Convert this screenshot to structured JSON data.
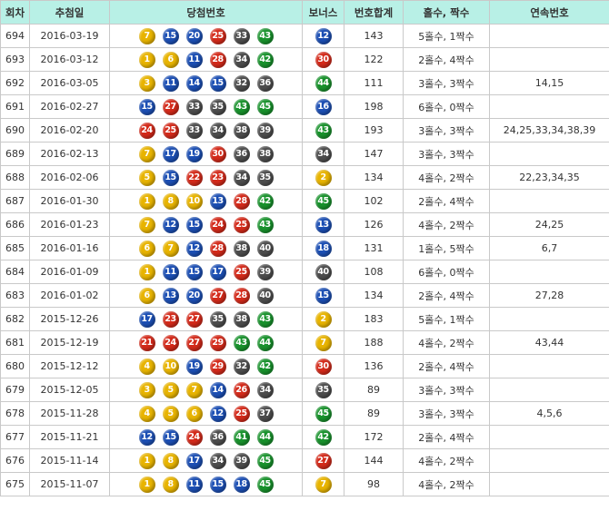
{
  "colors": {
    "header_bg": "#b8f0e6",
    "border": "#c9c9c9",
    "ball_yellow": "#e8b400",
    "ball_blue": "#1c4fb4",
    "ball_red": "#d42a1a",
    "ball_gray": "#4d4d4d",
    "ball_green": "#18922c"
  },
  "headers": {
    "round": "회차",
    "date": "추첨일",
    "winning": "당첨번호",
    "bonus": "보너스",
    "sum": "번호합계",
    "oddeven": "홀수, 짝수",
    "consec": "연속번호"
  },
  "rows": [
    {
      "round": "694",
      "date": "2016-03-19",
      "nums": [
        "7",
        "15",
        "20",
        "25",
        "33",
        "43"
      ],
      "bonus": "12",
      "sum": "143",
      "oddeven": "5홀수, 1짝수",
      "consec": ""
    },
    {
      "round": "693",
      "date": "2016-03-12",
      "nums": [
        "1",
        "6",
        "11",
        "28",
        "34",
        "42"
      ],
      "bonus": "30",
      "sum": "122",
      "oddeven": "2홀수, 4짝수",
      "consec": ""
    },
    {
      "round": "692",
      "date": "2016-03-05",
      "nums": [
        "3",
        "11",
        "14",
        "15",
        "32",
        "36"
      ],
      "bonus": "44",
      "sum": "111",
      "oddeven": "3홀수, 3짝수",
      "consec": "14,15"
    },
    {
      "round": "691",
      "date": "2016-02-27",
      "nums": [
        "15",
        "27",
        "33",
        "35",
        "43",
        "45"
      ],
      "bonus": "16",
      "sum": "198",
      "oddeven": "6홀수, 0짝수",
      "consec": ""
    },
    {
      "round": "690",
      "date": "2016-02-20",
      "nums": [
        "24",
        "25",
        "33",
        "34",
        "38",
        "39"
      ],
      "bonus": "43",
      "sum": "193",
      "oddeven": "3홀수, 3짝수",
      "consec": "24,25,33,34,38,39"
    },
    {
      "round": "689",
      "date": "2016-02-13",
      "nums": [
        "7",
        "17",
        "19",
        "30",
        "36",
        "38"
      ],
      "bonus": "34",
      "sum": "147",
      "oddeven": "3홀수, 3짝수",
      "consec": ""
    },
    {
      "round": "688",
      "date": "2016-02-06",
      "nums": [
        "5",
        "15",
        "22",
        "23",
        "34",
        "35"
      ],
      "bonus": "2",
      "sum": "134",
      "oddeven": "4홀수, 2짝수",
      "consec": "22,23,34,35"
    },
    {
      "round": "687",
      "date": "2016-01-30",
      "nums": [
        "1",
        "8",
        "10",
        "13",
        "28",
        "42"
      ],
      "bonus": "45",
      "sum": "102",
      "oddeven": "2홀수, 4짝수",
      "consec": ""
    },
    {
      "round": "686",
      "date": "2016-01-23",
      "nums": [
        "7",
        "12",
        "15",
        "24",
        "25",
        "43"
      ],
      "bonus": "13",
      "sum": "126",
      "oddeven": "4홀수, 2짝수",
      "consec": "24,25"
    },
    {
      "round": "685",
      "date": "2016-01-16",
      "nums": [
        "6",
        "7",
        "12",
        "28",
        "38",
        "40"
      ],
      "bonus": "18",
      "sum": "131",
      "oddeven": "1홀수, 5짝수",
      "consec": "6,7"
    },
    {
      "round": "684",
      "date": "2016-01-09",
      "nums": [
        "1",
        "11",
        "15",
        "17",
        "25",
        "39"
      ],
      "bonus": "40",
      "sum": "108",
      "oddeven": "6홀수, 0짝수",
      "consec": ""
    },
    {
      "round": "683",
      "date": "2016-01-02",
      "nums": [
        "6",
        "13",
        "20",
        "27",
        "28",
        "40"
      ],
      "bonus": "15",
      "sum": "134",
      "oddeven": "2홀수, 4짝수",
      "consec": "27,28"
    },
    {
      "round": "682",
      "date": "2015-12-26",
      "nums": [
        "17",
        "23",
        "27",
        "35",
        "38",
        "43"
      ],
      "bonus": "2",
      "sum": "183",
      "oddeven": "5홀수, 1짝수",
      "consec": ""
    },
    {
      "round": "681",
      "date": "2015-12-19",
      "nums": [
        "21",
        "24",
        "27",
        "29",
        "43",
        "44"
      ],
      "bonus": "7",
      "sum": "188",
      "oddeven": "4홀수, 2짝수",
      "consec": "43,44"
    },
    {
      "round": "680",
      "date": "2015-12-12",
      "nums": [
        "4",
        "10",
        "19",
        "29",
        "32",
        "42"
      ],
      "bonus": "30",
      "sum": "136",
      "oddeven": "2홀수, 4짝수",
      "consec": ""
    },
    {
      "round": "679",
      "date": "2015-12-05",
      "nums": [
        "3",
        "5",
        "7",
        "14",
        "26",
        "34"
      ],
      "bonus": "35",
      "sum": "89",
      "oddeven": "3홀수, 3짝수",
      "consec": ""
    },
    {
      "round": "678",
      "date": "2015-11-28",
      "nums": [
        "4",
        "5",
        "6",
        "12",
        "25",
        "37"
      ],
      "bonus": "45",
      "sum": "89",
      "oddeven": "3홀수, 3짝수",
      "consec": "4,5,6"
    },
    {
      "round": "677",
      "date": "2015-11-21",
      "nums": [
        "12",
        "15",
        "24",
        "36",
        "41",
        "44"
      ],
      "bonus": "42",
      "sum": "172",
      "oddeven": "2홀수, 4짝수",
      "consec": ""
    },
    {
      "round": "676",
      "date": "2015-11-14",
      "nums": [
        "1",
        "8",
        "17",
        "34",
        "39",
        "45"
      ],
      "bonus": "27",
      "sum": "144",
      "oddeven": "4홀수, 2짝수",
      "consec": ""
    },
    {
      "round": "675",
      "date": "2015-11-07",
      "nums": [
        "1",
        "8",
        "11",
        "15",
        "18",
        "45"
      ],
      "bonus": "7",
      "sum": "98",
      "oddeven": "4홀수, 2짝수",
      "consec": ""
    }
  ]
}
